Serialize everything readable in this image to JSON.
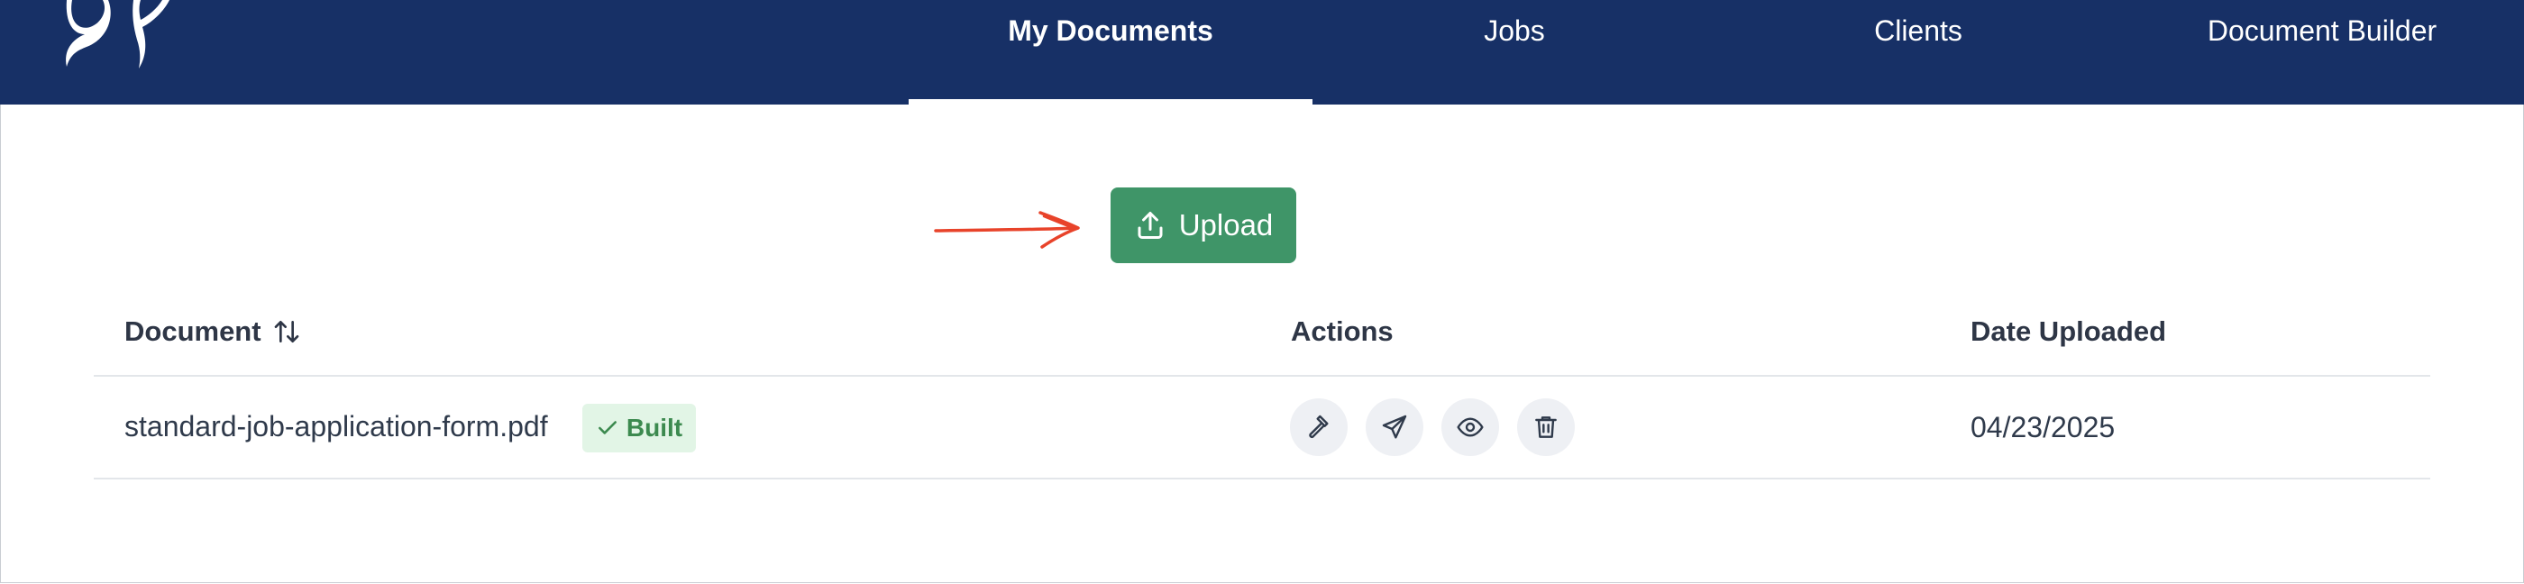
{
  "nav": {
    "tabs": [
      {
        "label": "My Documents",
        "active": true
      },
      {
        "label": "Jobs",
        "active": false
      },
      {
        "label": "Clients",
        "active": false
      },
      {
        "label": "Document Builder",
        "active": false
      }
    ]
  },
  "upload": {
    "label": "Upload",
    "icon": "upload-icon"
  },
  "table": {
    "headers": {
      "document": "Document",
      "actions": "Actions",
      "date_uploaded": "Date Uploaded"
    },
    "rows": [
      {
        "filename": "standard-job-application-form.pdf",
        "status": "Built",
        "actions": [
          "hammer-icon",
          "send-icon",
          "eye-icon",
          "trash-icon"
        ],
        "date": "04/23/2025"
      }
    ]
  },
  "colors": {
    "topbar": "#173066",
    "upload_button": "#3f9568",
    "badge_bg": "#e2f5e6",
    "badge_text": "#3c8a4f",
    "annotation_arrow": "#e8432a"
  }
}
